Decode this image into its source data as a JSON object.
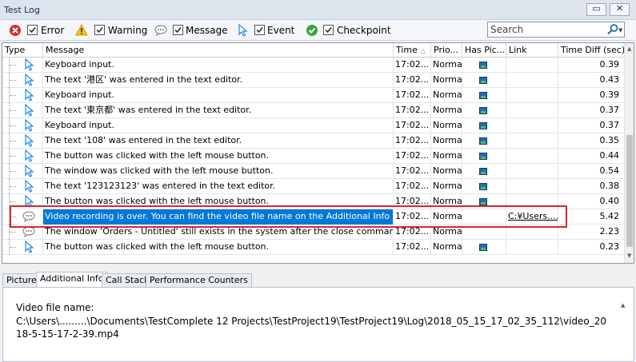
{
  "window": {
    "title": "Test Log",
    "restore_label": "▭",
    "close_label": "✕"
  },
  "filters": [
    {
      "label": "Error",
      "icon": "error-icon",
      "checked": true
    },
    {
      "label": "Warning",
      "icon": "warning-icon",
      "checked": true
    },
    {
      "label": "Message",
      "icon": "message-icon",
      "checked": true
    },
    {
      "label": "Event",
      "icon": "event-icon",
      "checked": true
    },
    {
      "label": "Checkpoint",
      "icon": "checkpoint-icon",
      "checked": true
    }
  ],
  "search": {
    "placeholder": "Search"
  },
  "columns": [
    "Type",
    "Message",
    "Time",
    "Prio...",
    "Has Pic...",
    "Link",
    "Time Diff (sec)"
  ],
  "rows": [
    {
      "type": "event",
      "message": "Keyboard input.",
      "time": "17:02...",
      "priority": "Normal",
      "has_picture": true,
      "link": "",
      "time_diff": "0.39"
    },
    {
      "type": "event",
      "message": "The text '港区' was entered in the text editor.",
      "time": "17:02...",
      "priority": "Normal",
      "has_picture": true,
      "link": "",
      "time_diff": "0.43"
    },
    {
      "type": "event",
      "message": "Keyboard input.",
      "time": "17:02...",
      "priority": "Normal",
      "has_picture": true,
      "link": "",
      "time_diff": "0.39"
    },
    {
      "type": "event",
      "message": "The text '東京都' was entered in the text editor.",
      "time": "17:02...",
      "priority": "Normal",
      "has_picture": true,
      "link": "",
      "time_diff": "0.37"
    },
    {
      "type": "event",
      "message": "Keyboard input.",
      "time": "17:02...",
      "priority": "Normal",
      "has_picture": true,
      "link": "",
      "time_diff": "0.37"
    },
    {
      "type": "event",
      "message": "The text '108' was entered in the text editor.",
      "time": "17:02...",
      "priority": "Normal",
      "has_picture": true,
      "link": "",
      "time_diff": "0.35"
    },
    {
      "type": "event",
      "message": "The button was clicked with the left mouse button.",
      "time": "17:02...",
      "priority": "Normal",
      "has_picture": true,
      "link": "",
      "time_diff": "0.44"
    },
    {
      "type": "event",
      "message": "The window was clicked with the left mouse button.",
      "time": "17:02...",
      "priority": "Normal",
      "has_picture": true,
      "link": "",
      "time_diff": "0.54"
    },
    {
      "type": "event",
      "message": "The text '123123123' was entered in the text editor.",
      "time": "17:02...",
      "priority": "Normal",
      "has_picture": true,
      "link": "",
      "time_diff": "0.38"
    },
    {
      "type": "event",
      "message": "The button was clicked with the left mouse button.",
      "time": "17:02...",
      "priority": "Normal",
      "has_picture": true,
      "link": "",
      "time_diff": "0.40"
    },
    {
      "type": "message",
      "message": "Video recording is over. You can find the video file name on the Additional Info tab.",
      "time": "17:02...",
      "priority": "Normal",
      "has_picture": false,
      "link": "C:¥Users....",
      "time_diff": "5.42",
      "selected": true
    },
    {
      "type": "message",
      "message": "The window 'Orders - Untitled' still exists in the system after the close command was us...",
      "time": "17:02...",
      "priority": "Normal",
      "has_picture": false,
      "link": "",
      "time_diff": "2.23"
    },
    {
      "type": "event",
      "message": "The button was clicked with the left mouse button.",
      "time": "17:02...",
      "priority": "Normal",
      "has_picture": true,
      "link": "",
      "time_diff": "0.23"
    }
  ],
  "tabs": [
    "Picture",
    "Additional Info",
    "Call Stack",
    "Performance Counters"
  ],
  "active_tab": "Additional Info",
  "additional_info": {
    "label": "Video file name:",
    "value": "C:\\Users\\.........\\Documents\\TestComplete 12 Projects\\TestProject19\\TestProject19\\Log\\2018_05_15_17_02_35_112\\video_2018-5-15-17-2-39.mp4"
  },
  "colors": {
    "selection": "#0078d7",
    "highlight_border": "#d6262c",
    "error": "#d9292e",
    "warning": "#f5c518",
    "checkpoint": "#3aa53a",
    "event": "#1e88e5"
  }
}
